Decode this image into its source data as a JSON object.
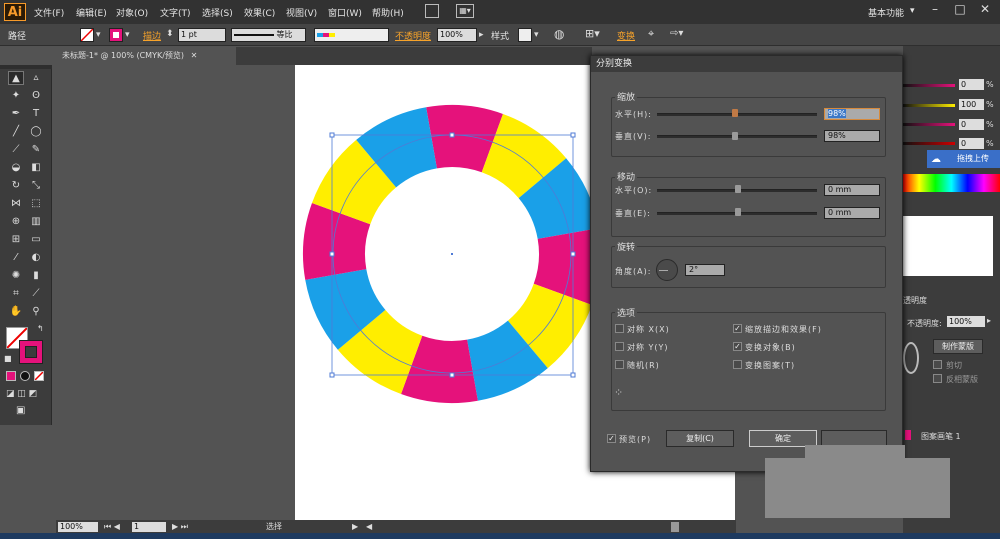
{
  "app": {
    "logo": "Ai",
    "workspace": "基本功能"
  },
  "menu": [
    "文件(F)",
    "编辑(E)",
    "对象(O)",
    "文字(T)",
    "选择(S)",
    "效果(C)",
    "视图(V)",
    "窗口(W)",
    "帮助(H)"
  ],
  "control": {
    "selection_type": "路径",
    "stroke_label": "描边",
    "stroke_weight": "1 pt",
    "stroke_profile": "等比",
    "opacity_label": "不透明度",
    "opacity": "100%",
    "style_label": "样式",
    "transform_label": "变换"
  },
  "document": {
    "tab_title": "未标题-1* @ 100% (CMYK/预览)",
    "zoom": "100%",
    "page": "1",
    "status_tool": "选择"
  },
  "dialog": {
    "title": "分别变换",
    "scale": {
      "label": "缩放",
      "horizontal_label": "水平(H):",
      "horizontal_value": "98%",
      "vertical_label": "垂直(V):",
      "vertical_value": "98%"
    },
    "move": {
      "label": "移动",
      "horizontal_label": "水平(O):",
      "horizontal_value": "0 mm",
      "vertical_label": "垂直(E):",
      "vertical_value": "0 mm"
    },
    "rotate": {
      "label": "旋转",
      "angle_label": "角度(A):",
      "angle_value": "2°"
    },
    "options": {
      "label": "选项",
      "reflect_x": {
        "label": "对称 X(X)",
        "checked": false
      },
      "reflect_y": {
        "label": "对称 Y(Y)",
        "checked": false
      },
      "random": {
        "label": "随机(R)",
        "checked": false
      },
      "scale_strokes": {
        "label": "缩放描边和效果(F)",
        "checked": true
      },
      "transform_objects": {
        "label": "变换对象(B)",
        "checked": true
      },
      "transform_patterns": {
        "label": "变换图案(T)",
        "checked": false
      }
    },
    "preview": {
      "label": "预览(P)",
      "checked": true
    },
    "copy_button": "复制(C)",
    "ok_button": "确定"
  },
  "right_panel": {
    "values": [
      "0",
      "100",
      "0",
      "0"
    ],
    "upload_label": "拖拽上传",
    "section_label": "透明度",
    "opacity_label": "不透明度:",
    "opacity_value": "100%",
    "make_mask": "制作蒙版",
    "clip": "剪切",
    "invert_mask": "反相蒙版",
    "layer_name": "图案画笔 1"
  },
  "colors": {
    "cyan": "#1aa0e8",
    "magenta": "#e5127b",
    "yellow": "#ffee00",
    "selection": "#4f7bd6"
  }
}
